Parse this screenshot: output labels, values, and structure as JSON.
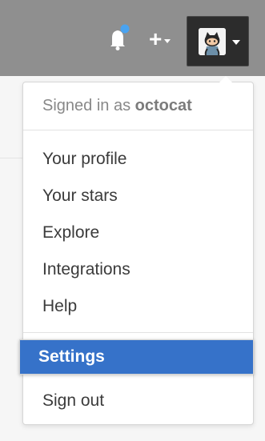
{
  "header": {
    "notification_icon": "bell-icon",
    "notification_dot_color": "#4aa3f0",
    "new_menu_icon": "plus-icon",
    "new_menu_label": "+",
    "avatar_icon": "octocat-avatar"
  },
  "menu": {
    "signed_in_prefix": "Signed in as",
    "username": "octocat",
    "items": [
      {
        "label": "Your profile"
      },
      {
        "label": "Your stars"
      },
      {
        "label": "Explore"
      },
      {
        "label": "Integrations"
      },
      {
        "label": "Help"
      },
      {
        "label": "Settings",
        "selected": true
      },
      {
        "label": "Sign out"
      }
    ]
  },
  "colors": {
    "header_bg": "#8f8f8f",
    "selected_bg": "#3672c9",
    "menu_text": "#3b3b3b"
  }
}
